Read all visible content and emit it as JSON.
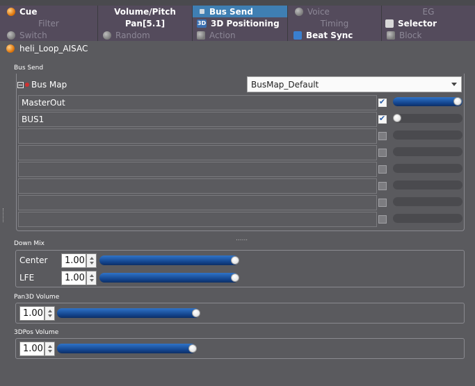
{
  "tabs": {
    "row1": [
      {
        "label": "Cue",
        "icon": "cue-orb-icon",
        "state": "normal"
      },
      {
        "label": "Volume/Pitch",
        "icon": "",
        "state": "normal"
      },
      {
        "label": "Bus Send",
        "icon": "bus-send-icon",
        "state": "active"
      },
      {
        "label": "Voice",
        "icon": "voice-icon",
        "state": "disabled"
      },
      {
        "label": "EG",
        "icon": "",
        "state": "disabled"
      }
    ],
    "row2": [
      {
        "label": "Filter",
        "icon": "",
        "state": "disabled"
      },
      {
        "label": "Pan[5.1]",
        "icon": "",
        "state": "normal"
      },
      {
        "label": "3D Positioning",
        "icon": "3d-icon",
        "state": "normal"
      },
      {
        "label": "Timing",
        "icon": "",
        "state": "disabled"
      },
      {
        "label": "Selector",
        "icon": "selector-icon",
        "state": "normal"
      }
    ],
    "row3": [
      {
        "label": "Switch",
        "icon": "switch-icon",
        "state": "disabled"
      },
      {
        "label": "Random",
        "icon": "random-icon",
        "state": "disabled"
      },
      {
        "label": "Action",
        "icon": "action-icon",
        "state": "disabled"
      },
      {
        "label": "Beat Sync",
        "icon": "beat-sync-icon",
        "state": "normal"
      },
      {
        "label": "Block",
        "icon": "block-icon",
        "state": "disabled"
      }
    ]
  },
  "cue": {
    "name": "heli_Loop_AISAC"
  },
  "bus_send": {
    "section_label": "Bus Send",
    "bus_map_label": "Bus Map",
    "bus_map_value": "BusMap_Default",
    "rows": [
      {
        "name": "MasterOut",
        "checked": true,
        "level": 1.0
      },
      {
        "name": "BUS1",
        "checked": true,
        "level": 0.0
      },
      {
        "name": "",
        "checked": false,
        "level": null
      },
      {
        "name": "",
        "checked": false,
        "level": null
      },
      {
        "name": "",
        "checked": false,
        "level": null
      },
      {
        "name": "",
        "checked": false,
        "level": null
      },
      {
        "name": "",
        "checked": false,
        "level": null
      },
      {
        "name": "",
        "checked": false,
        "level": null
      }
    ],
    "resize_grip": "......"
  },
  "down_mix": {
    "section_label": "Down Mix",
    "center_label": "Center",
    "center_value": "1.00",
    "center_level": 1.0,
    "lfe_label": "LFE",
    "lfe_value": "1.00",
    "lfe_level": 1.0
  },
  "pan3d_volume": {
    "section_label": "Pan3D Volume",
    "value": "1.00",
    "level": 1.0
  },
  "pos3d_volume": {
    "section_label": "3DPos Volume",
    "value": "1.00",
    "level": 1.0
  },
  "colors": {
    "active_tab": "#3f7fb3",
    "tab_bg": "#544b5c",
    "panel_bg": "#5a5a5e",
    "slider_fill": "#1f58a8"
  }
}
